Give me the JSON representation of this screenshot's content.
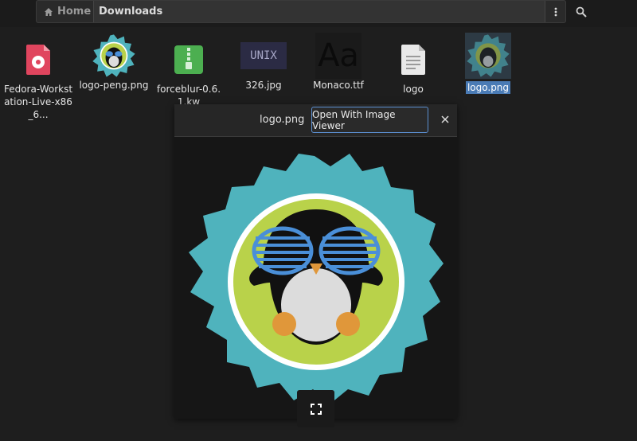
{
  "pathbar": {
    "home_label": "Home",
    "separator": "/",
    "current_folder": "Downloads"
  },
  "files": [
    {
      "name": "Fedora-Workstation-Live-x86_6...",
      "icon": "disc-image-icon",
      "selected": false
    },
    {
      "name": "logo-peng.png",
      "icon": "penguin-logo-thumbnail",
      "selected": false
    },
    {
      "name": "forceblur-0.6.1.kw",
      "icon": "archive-zip-icon",
      "selected": false
    },
    {
      "name": "326.jpg",
      "icon": "unix-image-thumbnail",
      "selected": false
    },
    {
      "name": "Monaco.ttf",
      "icon": "font-preview-thumbnail",
      "selected": false
    },
    {
      "name": "logo",
      "icon": "text-document-icon",
      "selected": false
    },
    {
      "name": "logo.png",
      "icon": "penguin-logo-thumbnail",
      "selected": true
    }
  ],
  "thumbnails": {
    "unix_text": "UNIX",
    "font_sample": "Aa"
  },
  "preview": {
    "filename": "logo.png",
    "open_button": "Open With Image Viewer"
  },
  "colors": {
    "selection": "#4a7bb5",
    "gear": "#4fb3bd",
    "badge_green": "#b9d24a",
    "glasses": "#4a8fd8",
    "feet": "#e0973a"
  }
}
